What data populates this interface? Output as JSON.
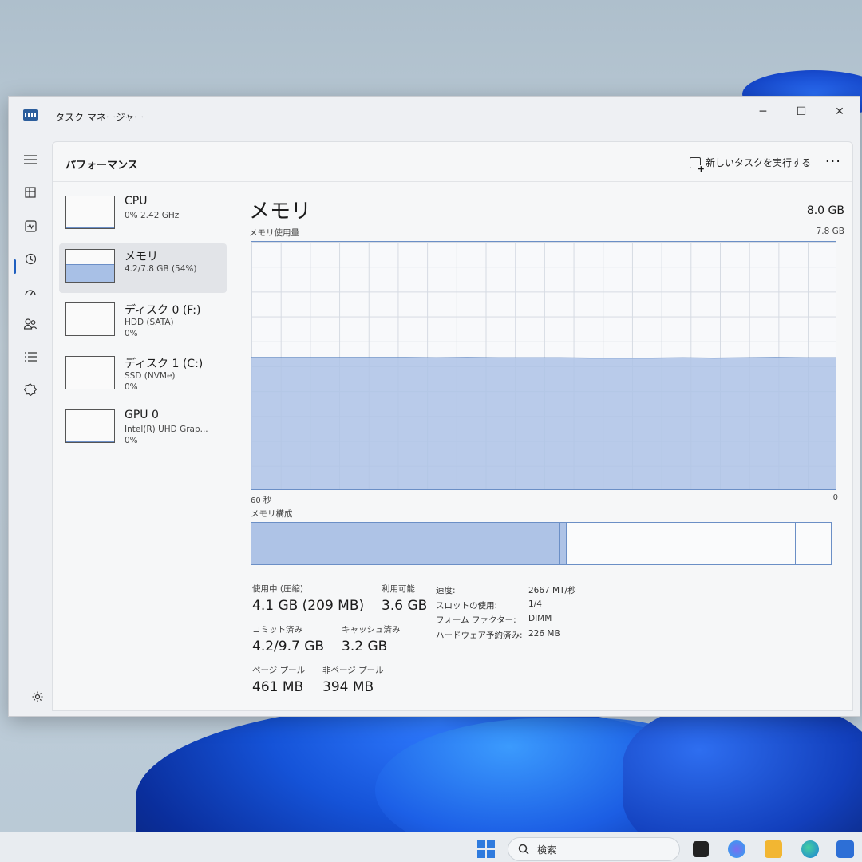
{
  "window": {
    "title": "タスク マネージャー",
    "controls": {
      "minimize": "─",
      "maximize": "☐",
      "close": "✕"
    }
  },
  "header": {
    "title": "パフォーマンス",
    "run_new_task": "新しいタスクを実行する",
    "more": "···"
  },
  "devices": [
    {
      "name": "CPU",
      "line1": "0%  2.42 GHz",
      "line2": "",
      "fill": 0.02
    },
    {
      "name": "メモリ",
      "line1": "4.2/7.8 GB (54%)",
      "line2": "",
      "fill": 0.54
    },
    {
      "name": "ディスク 0 (F:)",
      "line1": "HDD (SATA)",
      "line2": "0%",
      "fill": 0.0
    },
    {
      "name": "ディスク 1 (C:)",
      "line1": "SSD (NVMe)",
      "line2": "0%",
      "fill": 0.0
    },
    {
      "name": "GPU 0",
      "line1": "Intel(R) UHD Grap...",
      "line2": "0%",
      "fill": 0.03
    }
  ],
  "memory": {
    "title": "メモリ",
    "total": "8.0 GB",
    "usage_label": "メモリ使用量",
    "usage_max": "7.8 GB",
    "axis_left": "60 秒",
    "axis_right": "0",
    "composition_label": "メモリ構成",
    "composition": {
      "in_use_fraction": 0.53,
      "modified_fraction": 0.012,
      "standby_fraction": 0.395
    },
    "stats": {
      "in_use_label": "使用中 (圧縮)",
      "in_use_value": "4.1 GB (209 MB)",
      "available_label": "利用可能",
      "available_value": "3.6 GB",
      "committed_label": "コミット済み",
      "committed_value": "4.2/9.7 GB",
      "cached_label": "キャッシュ済み",
      "cached_value": "3.2 GB",
      "paged_label": "ページ プール",
      "paged_value": "461 MB",
      "nonpaged_label": "非ページ プール",
      "nonpaged_value": "394 MB"
    },
    "properties": [
      {
        "key": "速度:",
        "value": "2667 MT/秒"
      },
      {
        "key": "スロットの使用:",
        "value": "1/4"
      },
      {
        "key": "フォーム ファクター:",
        "value": "DIMM"
      },
      {
        "key": "ハードウェア予約済み:",
        "value": "226 MB"
      }
    ]
  },
  "chart_data": {
    "type": "area",
    "title": "メモリ使用量",
    "xlabel": "",
    "ylabel": "",
    "x_range_label": [
      "60 秒",
      "0"
    ],
    "ylim": [
      0,
      7.8
    ],
    "series": [
      {
        "values": [
          4.18,
          4.18,
          4.18,
          4.18,
          4.18,
          4.18,
          4.17,
          4.18,
          4.17,
          4.17,
          4.17,
          4.16,
          4.16,
          4.16,
          4.17,
          4.16,
          4.17,
          4.18,
          4.17,
          4.17
        ]
      }
    ]
  },
  "taskbar": {
    "search_placeholder": "検索",
    "search_icon": "search-icon"
  },
  "colors": {
    "graph_fill": "#aec3e6",
    "graph_line": "#6b8fc6",
    "accent": "#1f5fbf"
  }
}
